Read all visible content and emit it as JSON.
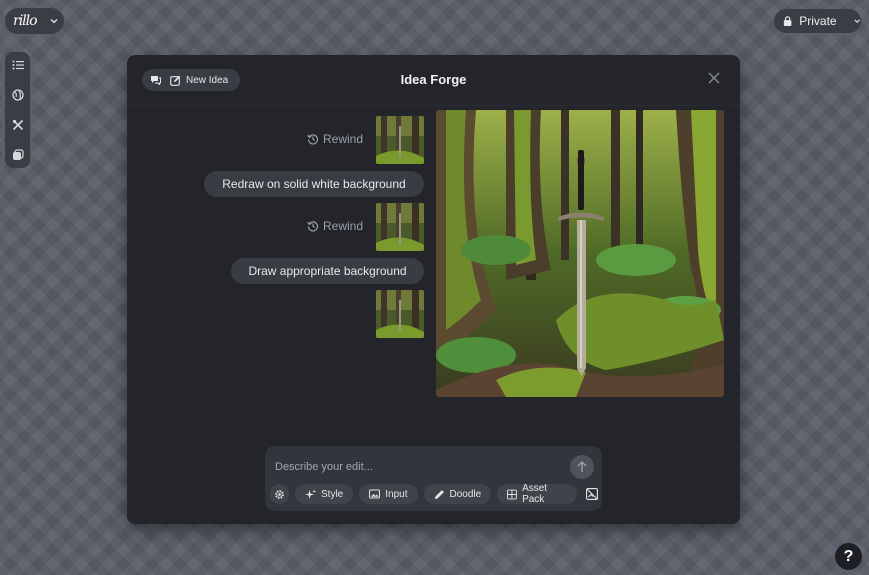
{
  "app": {
    "logo_text": "rillo"
  },
  "privacy": {
    "label": "Private"
  },
  "sidebar": {
    "items": [
      {
        "icon": "list-icon"
      },
      {
        "icon": "globe-icon"
      },
      {
        "icon": "tools-icon"
      },
      {
        "icon": "library-icon"
      }
    ]
  },
  "panel": {
    "title": "Idea Forge",
    "new_idea_label": "New Idea"
  },
  "chat": {
    "rewind_label": "Rewind",
    "messages": [
      {
        "text": "Redraw on solid white background"
      },
      {
        "text": "Draw appropriate background"
      }
    ]
  },
  "composer": {
    "placeholder": "Describe your edit...",
    "value": "",
    "tools": [
      {
        "label": "Style",
        "icon": "sparkle-icon"
      },
      {
        "label": "Input",
        "icon": "image-icon"
      },
      {
        "label": "Doodle",
        "icon": "pencil-icon"
      },
      {
        "label": "Asset Pack",
        "icon": "grid-icon"
      }
    ]
  },
  "help": {
    "label": "?"
  },
  "colors": {
    "panel": "#23252b",
    "pill": "#3b3d45",
    "background": "#5a5d68"
  }
}
